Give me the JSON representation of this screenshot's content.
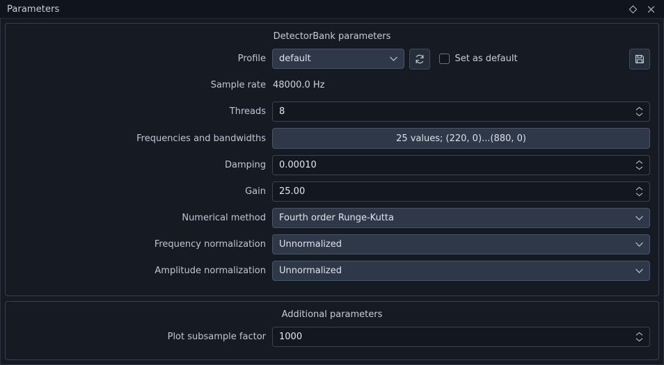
{
  "window": {
    "title": "Parameters",
    "buttons": [
      {
        "name": "float-window-button",
        "icon": "diamond-icon"
      },
      {
        "name": "close-window-button",
        "icon": "close-icon"
      }
    ]
  },
  "colors": {
    "window_background": "#161a23",
    "titlebar_background": "#10141c",
    "groupbox_border": "#39414f",
    "combobox_background": "#2e3848",
    "combobox_border": "#4a5568",
    "input_background": "#131720",
    "input_border": "#3c4454",
    "label_text": "#bfc6d4",
    "value_text": "#e4e8f0"
  },
  "primary_group": {
    "title": "DetectorBank parameters",
    "profile_row": {
      "label": "Profile",
      "value": "default",
      "refresh_tooltip": "Refresh",
      "checkbox_label": "Set as default",
      "checkbox_checked": false,
      "save_tooltip": "Save"
    },
    "rows": [
      {
        "label": "Sample rate",
        "value": "48000.0 Hz",
        "kind": "static"
      },
      {
        "label": "Threads",
        "value": "8",
        "kind": "spinbox"
      },
      {
        "label": "Frequencies and bandwidths",
        "value": "25 values; (220, 0)...(880, 0)",
        "kind": "button"
      },
      {
        "label": "Damping",
        "value": "0.00010",
        "kind": "spinbox"
      },
      {
        "label": "Gain",
        "value": "25.00",
        "kind": "spinbox"
      },
      {
        "label": "Numerical method",
        "value": "Fourth order Runge-Kutta",
        "kind": "combobox"
      },
      {
        "label": "Frequency normalization",
        "value": "Unnormalized",
        "kind": "combobox"
      },
      {
        "label": "Amplitude normalization",
        "value": "Unnormalized",
        "kind": "combobox"
      }
    ]
  },
  "secondary_group": {
    "title": "Additional parameters",
    "rows": [
      {
        "label": "Plot subsample factor",
        "value": "1000",
        "kind": "spinbox"
      }
    ]
  }
}
